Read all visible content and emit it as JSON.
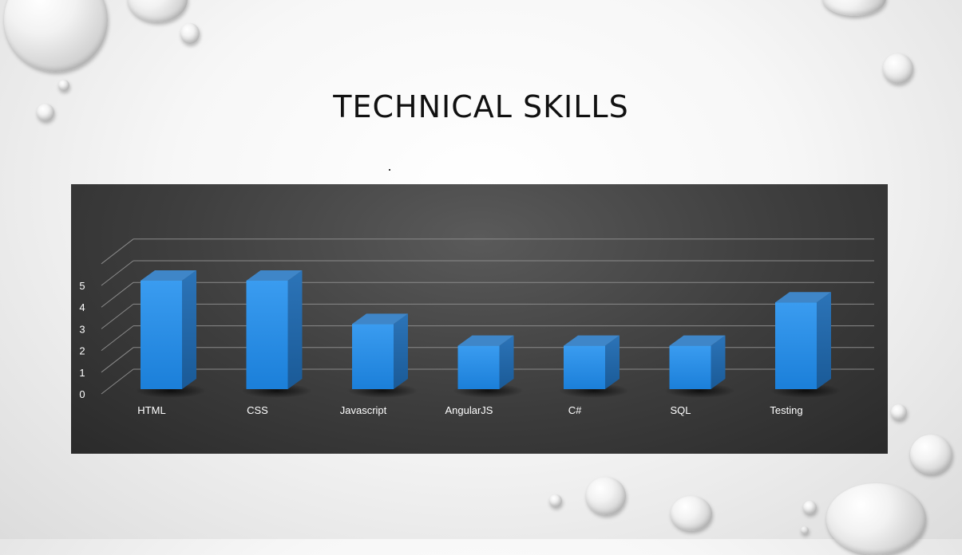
{
  "slide": {
    "title": "TECHNICAL SKILLS",
    "background_color": "#f4f4f4"
  },
  "chart_data": {
    "type": "bar",
    "style": "3d-column",
    "categories": [
      "HTML",
      "CSS",
      "Javascript",
      "AngularJS",
      "C#",
      "SQL",
      "Testing"
    ],
    "values": [
      5,
      5,
      3,
      2,
      2,
      2,
      4
    ],
    "ylim": [
      0,
      6
    ],
    "yticks": [
      "0",
      "1",
      "2",
      "3",
      "4",
      "5"
    ],
    "grid": true,
    "legend": "none",
    "bar_color": "#2e8fe0",
    "panel_color": "#3d3d3d"
  }
}
